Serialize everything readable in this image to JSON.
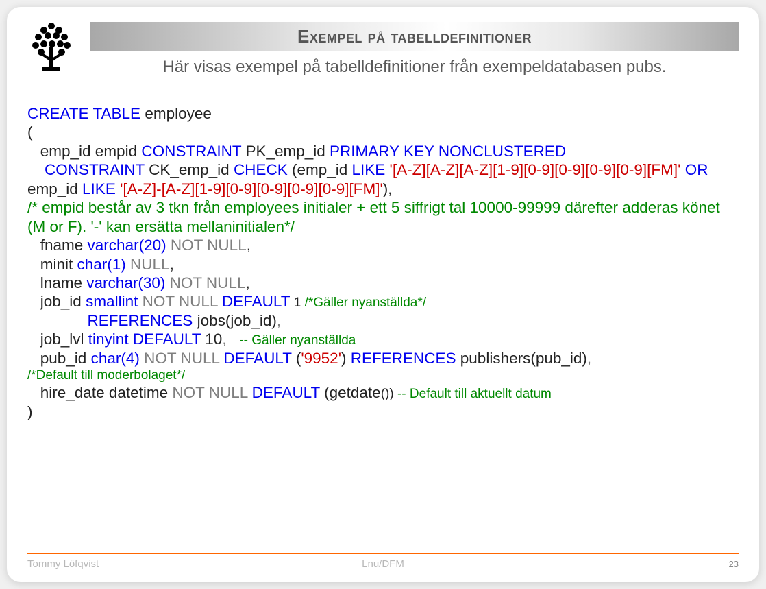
{
  "header": {
    "title": "Exempel på tabelldefinitioner",
    "subtitle": "Här visas exempel på tabelldefinitioner från exempeldatabasen pubs."
  },
  "code": {
    "l1_kw": "CREATE TABLE",
    "l1_txt": " employee",
    "l2": "(",
    "l3_ind": "   emp_id empid ",
    "l3_kw1": "CONSTRAINT",
    "l3_txt1": " PK_emp_id ",
    "l3_kw2": "PRIMARY KEY NONCLUSTERED",
    "l4_ind": "    ",
    "l4_kw1": "CONSTRAINT",
    "l4_txt1": " CK_emp_id ",
    "l4_kw2": "CHECK",
    "l4_txt2": " (emp_id ",
    "l4_kw3": "LIKE",
    "l4_str1": " '[A-Z][A-Z][A-Z][1-9][0-9][0-9][0-9][0-9][FM]'",
    "l4_or": "  OR",
    "l4_txt3": " emp_id ",
    "l4_kw4": "LIKE",
    "l4_str2": " '[A-Z]-[A-Z][1-9][0-9][0-9][0-9][0-9][FM]'",
    "l4_close": "),",
    "l5_cmt": "   /* empid består av 3 tkn från employees initialer + ett 5 siffrigt tal 10000-99999 därefter adderas könet (M or F). '-' kan ersätta mellaninitialen*/",
    "l6_ind": "   fname ",
    "l6_kw": "varchar(20)",
    "l6_gr": " NOT NULL",
    "l6_end": ",",
    "l7_ind": "   minit ",
    "l7_kw": "char(1)",
    "l7_gr": " NULL",
    "l7_end": ",",
    "l8_ind": "   lname ",
    "l8_kw": "varchar(30)",
    "l8_gr": " NOT NULL",
    "l8_end": ",",
    "l9_ind": "   job_id ",
    "l9_kw1": "smallint",
    "l9_gr": " NOT NULL ",
    "l9_kw2": "DEFAULT",
    "l9_txt": " 1 ",
    "l9_cmt": "/*Gäller nyanställda*/",
    "l10_ind": "              ",
    "l10_kw": "REFERENCES",
    "l10_txt": " jobs(job_id)",
    "l10_end": ",",
    "l11_ind": "   job_lvl ",
    "l11_kw1": "tinyint",
    "l11_sp": " ",
    "l11_kw2": "DEFAULT",
    "l11_txt": " 10",
    "l11_end": ",   ",
    "l11_cmt": "-- Gäller nyanställda",
    "l12_ind": "   pub_id ",
    "l12_kw1": "char(4)",
    "l12_gr": " NOT NULL ",
    "l12_kw2": "DEFAULT",
    "l12_txt1": " (",
    "l12_str": "'9952'",
    "l12_txt2": ") ",
    "l12_kw3": "REFERENCES",
    "l12_txt3": " publishers(pub_id)",
    "l12_end": ",",
    "l13_cmt": "/*Default till  moderbolaget*/",
    "l14_ind": "   hire_date datetime ",
    "l14_gr": "NOT NULL ",
    "l14_kw": "DEFAULT",
    "l14_txt1": " (getdate",
    "l14_txt2": "())  ",
    "l14_cmt": "-- Default till aktuellt datum",
    "l15": " )"
  },
  "footer": {
    "left": "Tommy Löfqvist",
    "center": "Lnu/DFM",
    "page": "23"
  }
}
